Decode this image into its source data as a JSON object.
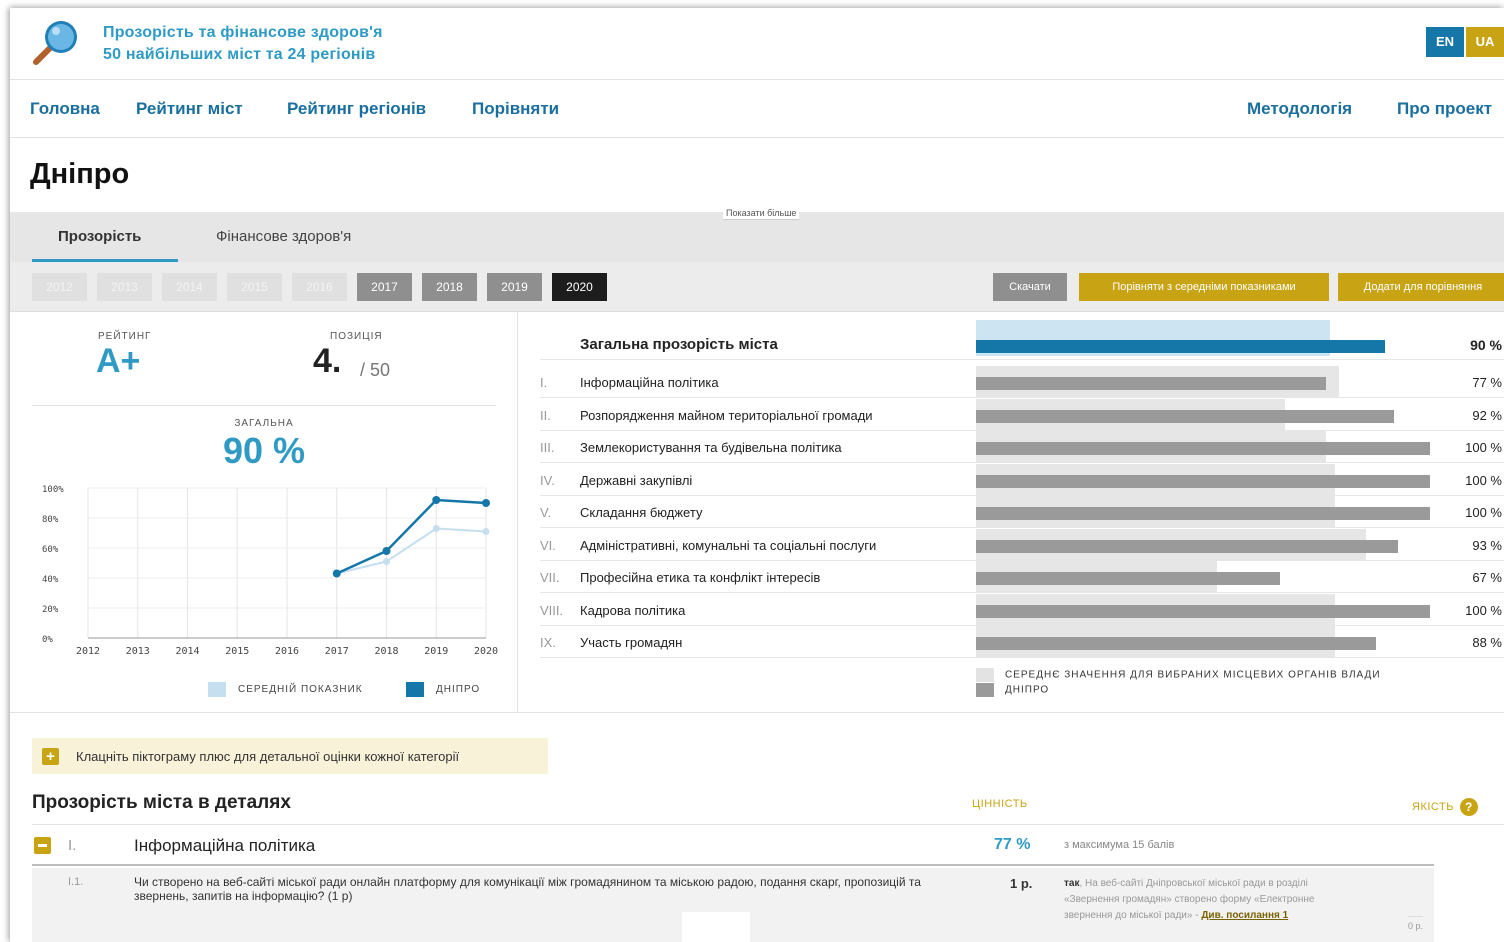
{
  "header": {
    "title_line1": "Прозорість та фінансове здоров'я",
    "title_line2": "50 найбільших міст та 24 регіонів",
    "logo_icon": "magnifier-icon",
    "lang_en": "EN",
    "lang_ua": "UA"
  },
  "nav": {
    "home": "Головна",
    "city_rating": "Рейтинг міст",
    "region_rating": "Рейтинг регіонів",
    "compare": "Порівняти",
    "methodology": "Методологія",
    "about": "Про проект"
  },
  "city": {
    "name": "Дніпро"
  },
  "tabs": {
    "transparency": "Прозорість",
    "financial": "Фінансове здоров'я",
    "show_more": "Показати більше"
  },
  "years": {
    "disabled": [
      "2012",
      "2013",
      "2014",
      "2015",
      "2016"
    ],
    "available": [
      "2017",
      "2018",
      "2019"
    ],
    "selected": "2020"
  },
  "actions": {
    "download": "Скачати",
    "compare_avg": "Порівняти з середніми показниками",
    "add_compare": "Додати для порівняння"
  },
  "summary": {
    "rating_label": "РЕЙТИНГ",
    "rating_value": "A+",
    "position_label": "ПОЗИЦІЯ",
    "position_value": "4.",
    "position_total": "/ 50",
    "overall_label": "ЗАГАЛЬНА",
    "overall_value": "90 %"
  },
  "chart_data": {
    "type": "line",
    "x": [
      "2012",
      "2013",
      "2014",
      "2015",
      "2016",
      "2017",
      "2018",
      "2019",
      "2020"
    ],
    "yticks": [
      "0%",
      "20%",
      "40%",
      "60%",
      "80%",
      "100%"
    ],
    "ylim": [
      0,
      100
    ],
    "series": [
      {
        "name": "СЕРЕДНІЙ ПОКАЗНИК",
        "color": "#c5dff0",
        "values": [
          null,
          null,
          null,
          null,
          null,
          43,
          51,
          73,
          71
        ]
      },
      {
        "name": "ДНІПРО",
        "color": "#1477a8",
        "values": [
          null,
          null,
          null,
          null,
          null,
          43,
          58,
          92,
          90
        ]
      }
    ],
    "legend": "bottom"
  },
  "categories": {
    "overall": {
      "label": "Загальна прозорість міста",
      "value": 90,
      "avg": 78,
      "pct": "90 %"
    },
    "items": [
      {
        "num": "I.",
        "label": "Інформаційна політика",
        "value": 77,
        "avg": 80,
        "pct": "77 %"
      },
      {
        "num": "II.",
        "label": "Розпорядження майном територіальної громади",
        "value": 92,
        "avg": 68,
        "pct": "92 %"
      },
      {
        "num": "III.",
        "label": "Землекористування та будівельна політика",
        "value": 100,
        "avg": 77,
        "pct": "100 %"
      },
      {
        "num": "IV.",
        "label": "Державні закупівлі",
        "value": 100,
        "avg": 79,
        "pct": "100 %"
      },
      {
        "num": "V.",
        "label": "Складання бюджету",
        "value": 100,
        "avg": 79,
        "pct": "100 %"
      },
      {
        "num": "VI.",
        "label": "Адміністративні, комунальні та соціальні послуги",
        "value": 93,
        "avg": 86,
        "pct": "93 %"
      },
      {
        "num": "VII.",
        "label": "Професійна етика та конфлікт інтересів",
        "value": 67,
        "avg": 53,
        "pct": "67 %"
      },
      {
        "num": "VIII.",
        "label": "Кадрова політика",
        "value": 100,
        "avg": 79,
        "pct": "100 %"
      },
      {
        "num": "IX.",
        "label": "Участь громадян",
        "value": 88,
        "avg": 79,
        "pct": "88 %"
      }
    ],
    "legend_avg": "СЕРЕДНЄ ЗНАЧЕННЯ ДЛЯ ВИБРАНИХ МІСЦЕВИХ ОРГАНІВ ВЛАДИ",
    "legend_city": "ДНІПРО"
  },
  "colors": {
    "accent": "#2f9bc4",
    "brand_blue": "#1477a8",
    "gold": "#c8a415"
  },
  "hint": {
    "text": "Клацніть піктограму плюс для детальної оцінки кожної категорії"
  },
  "details": {
    "title": "Прозорість міста в деталях",
    "col_value": "ЦІННІСТЬ",
    "col_quality": "ЯКІСТЬ",
    "section": {
      "num": "I.",
      "label": "Інформаційна політика",
      "pct": "77 %",
      "max": "з максимума 15 балів"
    },
    "question": {
      "num": "I.1.",
      "text": "Чи створено на веб-сайті міської ради онлайн платформу для комунікації між громадянином та міською радою, подання скарг, пропозицій та звернень, запитів на інформацію? (1 р)",
      "points": "1 р.",
      "answer_bold": "так",
      "answer_text": ", На веб-сайті Дніпровської міської ради в розділі «Звернення громадян» створено форму «Електронне звернення до міської ради» - ",
      "answer_link": "Див. посилання 1",
      "quality_points": "0 р."
    }
  }
}
